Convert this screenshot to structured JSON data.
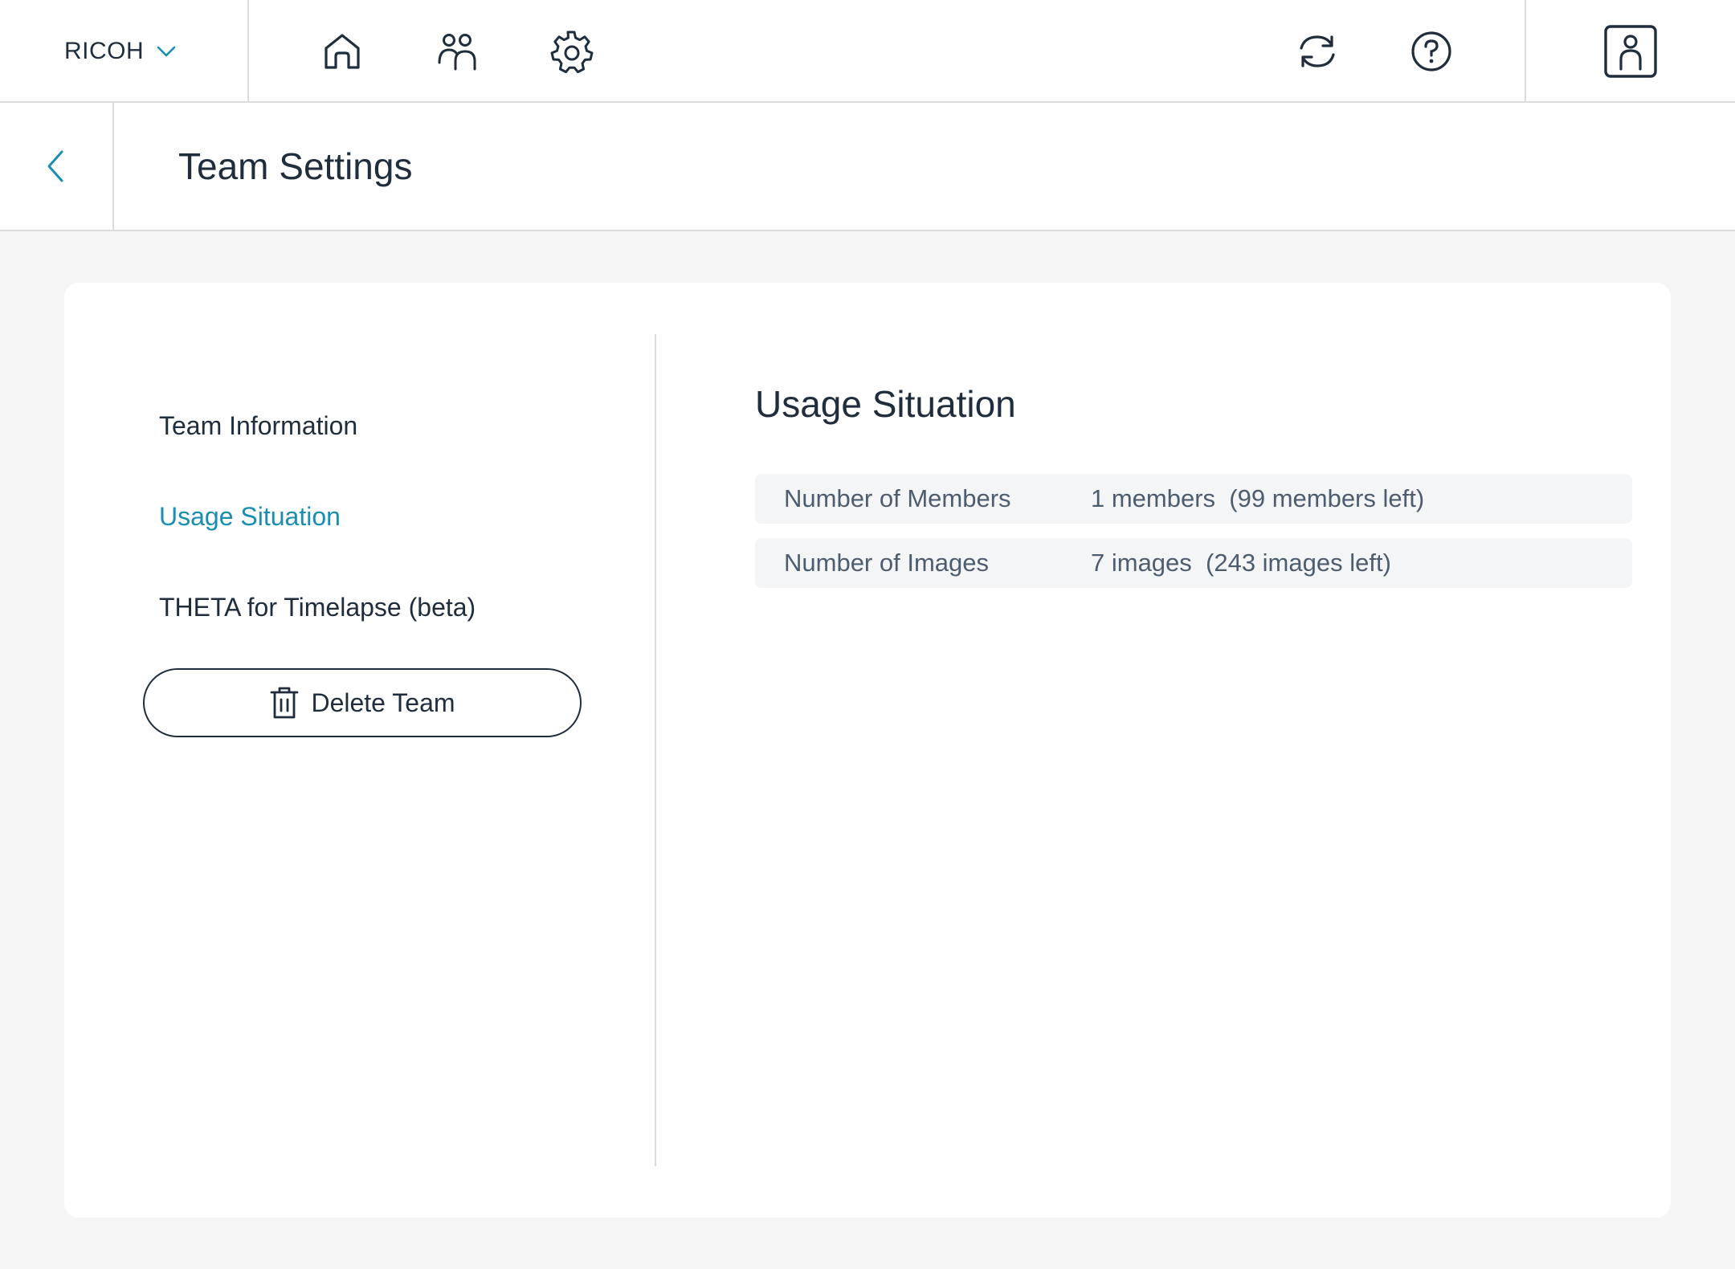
{
  "header": {
    "team_name": "RICOH",
    "icons": [
      "home-icon",
      "members-icon",
      "settings-icon",
      "sync-icon",
      "help-icon",
      "account-icon"
    ]
  },
  "subheader": {
    "title": "Team Settings"
  },
  "sidebar": {
    "items": [
      {
        "label": "Team Information",
        "active": false
      },
      {
        "label": "Usage Situation",
        "active": true
      },
      {
        "label": "THETA for Timelapse (beta)",
        "active": false
      }
    ],
    "delete_label": "Delete Team"
  },
  "usage": {
    "title": "Usage Situation",
    "rows": [
      {
        "label": "Number of Members",
        "value": "1 members  (99 members left)"
      },
      {
        "label": "Number of Images",
        "value": "7 images  (243 images left)"
      }
    ]
  },
  "colors": {
    "accent": "#1a8db3",
    "text": "#1f2d3d",
    "muted_text": "#4d5d70",
    "page_bg": "#f5f5f5",
    "row_bg": "#f4f5f7",
    "border": "#dcdcdc"
  }
}
